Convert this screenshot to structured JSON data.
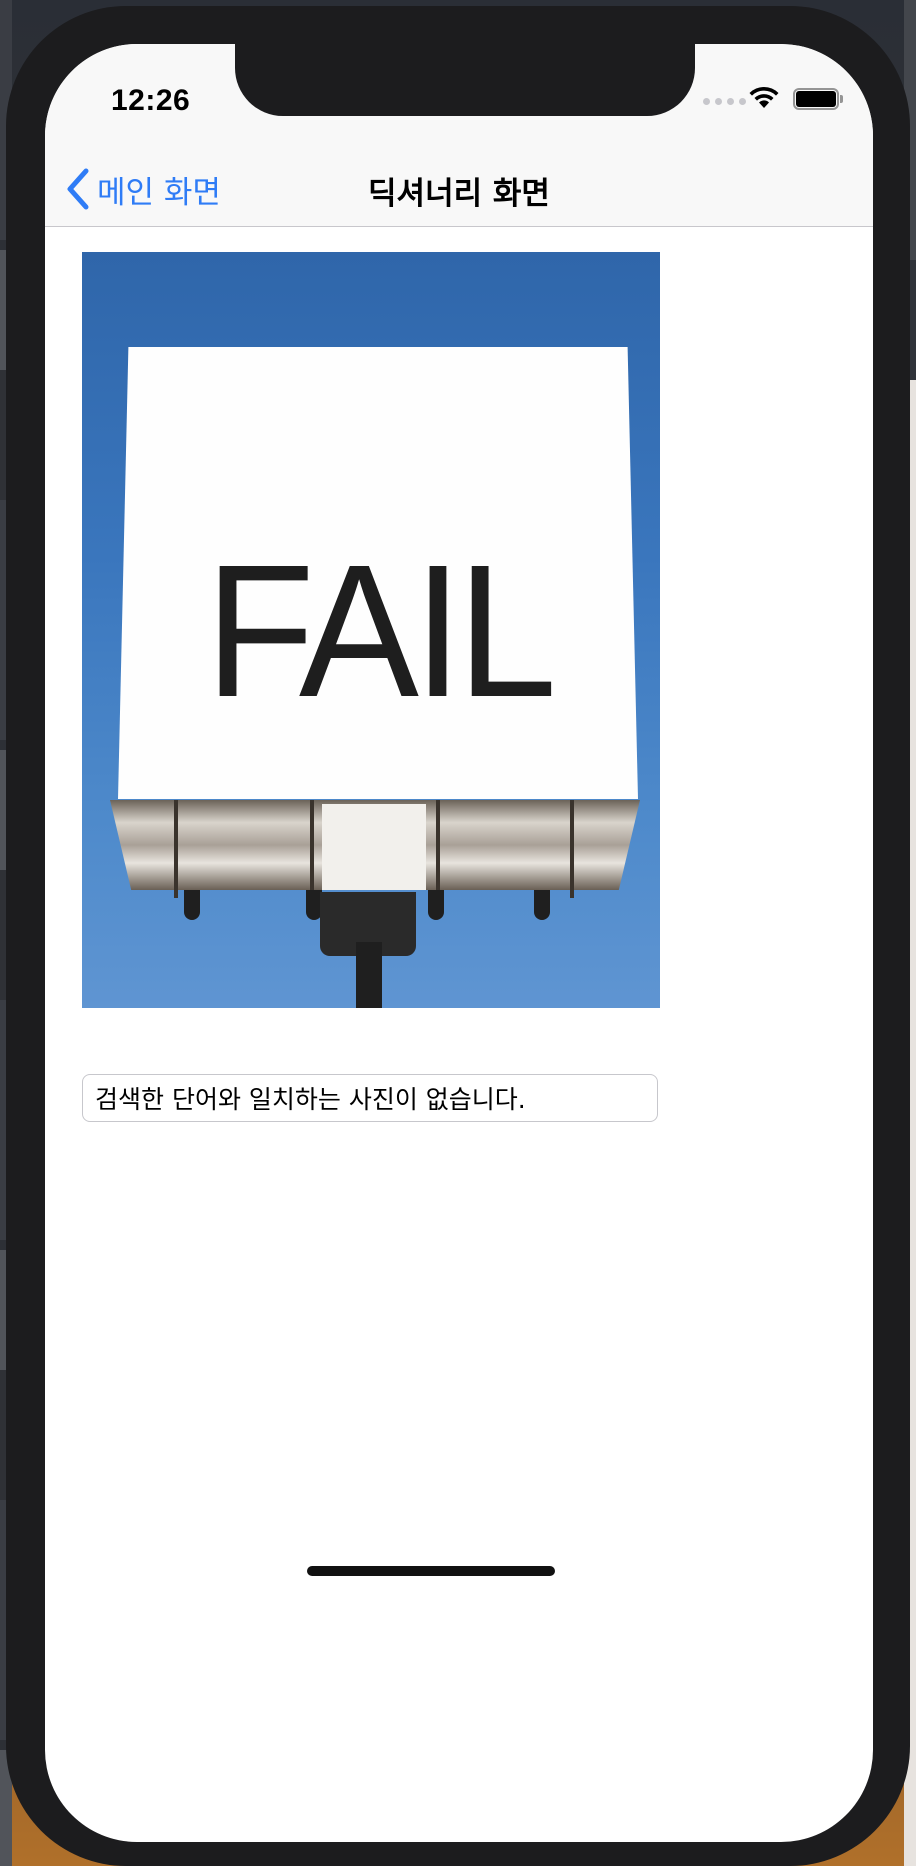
{
  "status_bar": {
    "time": "12:26",
    "signal_icon": "cellular-signal-icon",
    "wifi_icon": "wifi-icon",
    "battery_icon": "battery-icon"
  },
  "nav_bar": {
    "back_label": "메인 화면",
    "back_icon": "chevron-left-icon",
    "title": "딕셔너리 화면",
    "accent_color": "#2F7CF6"
  },
  "image": {
    "caption_text": "FAIL"
  },
  "result_field": {
    "value": "검색한 단어와 일치하는 사진이 없습니다."
  }
}
